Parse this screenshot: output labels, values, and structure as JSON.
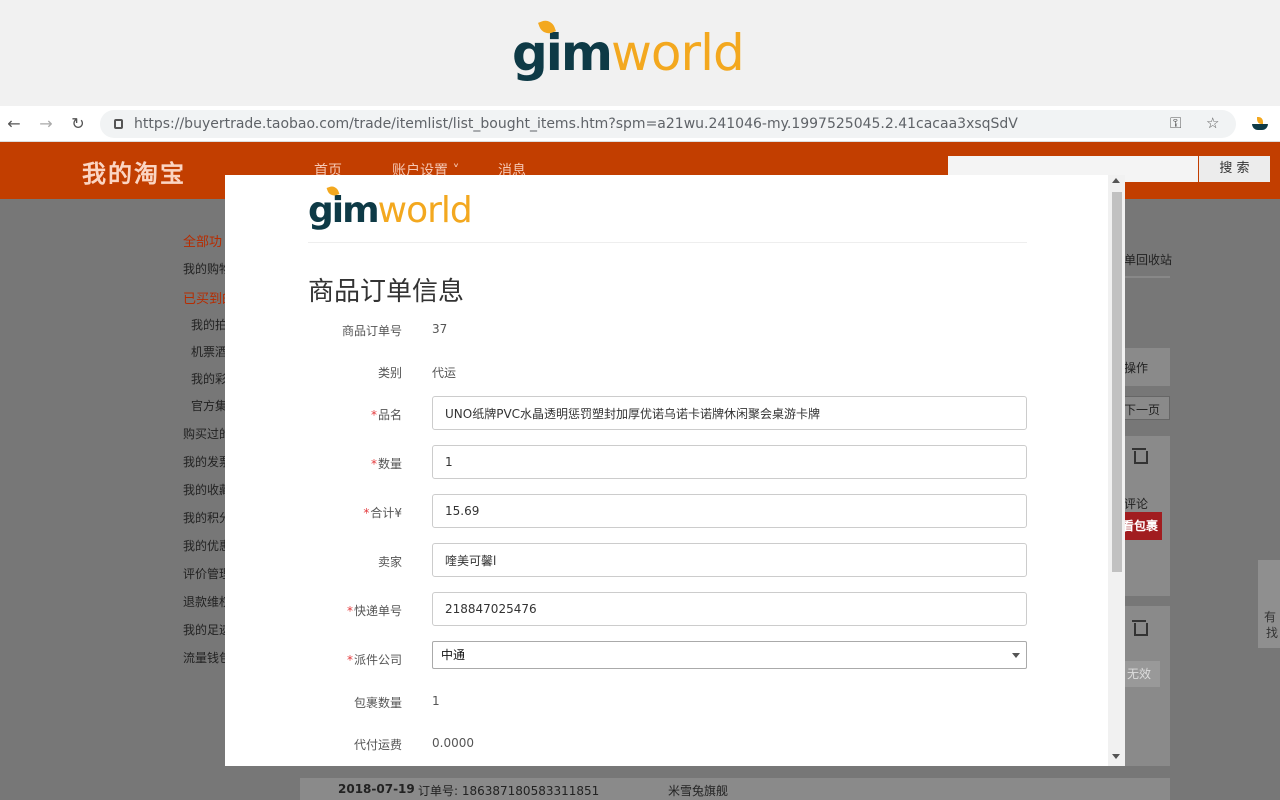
{
  "banner": {
    "logo_gim": "gim",
    "logo_world": "world"
  },
  "browser": {
    "url": "https://buyertrade.taobao.com/trade/itemlist/list_bought_items.htm?spm=a21wu.241046-my.1997525045.2.41cacaa3xsqSdV",
    "back_icon": "←",
    "forward_icon": "→",
    "reload_icon": "↻",
    "key_icon": "⚿",
    "star_icon": "☆"
  },
  "taobao": {
    "title": "我的淘宝",
    "nav": [
      "首页",
      "账户设置 ˅",
      "消息"
    ],
    "search_button": "搜 索",
    "sidebar": [
      {
        "label": "全部功",
        "style": "red"
      },
      {
        "label": "我的购物",
        "style": "normal"
      },
      {
        "label": "已买到的",
        "style": "red"
      },
      {
        "label": "我的拍",
        "style": "sub"
      },
      {
        "label": "机票酒",
        "style": "sub"
      },
      {
        "label": "我的彩",
        "style": "sub"
      },
      {
        "label": "官方集",
        "style": "sub"
      },
      {
        "label": "购买过的",
        "style": "normal"
      },
      {
        "label": "我的发票",
        "style": "normal"
      },
      {
        "label": "我的收藏",
        "style": "normal"
      },
      {
        "label": "我的积分",
        "style": "normal"
      },
      {
        "label": "我的优惠",
        "style": "normal"
      },
      {
        "label": "评价管理",
        "style": "normal"
      },
      {
        "label": "退款维权",
        "style": "normal"
      },
      {
        "label": "我的足迹",
        "style": "normal"
      },
      {
        "label": "流量钱包",
        "style": "normal"
      }
    ],
    "right": {
      "recycle": "单回收站",
      "operate": "操作",
      "next_page": "下一页",
      "comment": "评论",
      "package": "看包裹",
      "invalid": "无效",
      "float_text": "有",
      "float_text2": "找"
    },
    "bottom_row": {
      "date": "2018-07-19",
      "order_label": "订单号: 186387180583311851",
      "shop": "米雪兔旗舰"
    }
  },
  "modal": {
    "logo_gim": "gim",
    "logo_world": "world",
    "title": "商品订单信息",
    "fields": {
      "order_no_label": "商品订单号",
      "order_no": "37",
      "category_label": "类别",
      "category": "代运",
      "name_label": "品名",
      "name": "UNO纸牌PVC水晶透明惩罚塑封加厚优诺乌诺卡诺牌休闲聚会桌游卡牌",
      "qty_label": "数量",
      "qty": "1",
      "total_label": "合计¥",
      "total": "15.69",
      "seller_label": "卖家",
      "seller": "喹美可馨l",
      "tracking_label": "快递单号",
      "tracking": "218847025476",
      "courier_label": "派件公司",
      "courier": "中通",
      "pkg_count_label": "包裹数量",
      "pkg_count": "1",
      "freight_label": "代付运费",
      "freight": "0.0000"
    },
    "required_mark": "*"
  },
  "colors": {
    "taobao_orange": "#c23e00",
    "logo_dark": "#0e3a46",
    "logo_gold": "#f3a81f",
    "required": "#e4393c"
  }
}
